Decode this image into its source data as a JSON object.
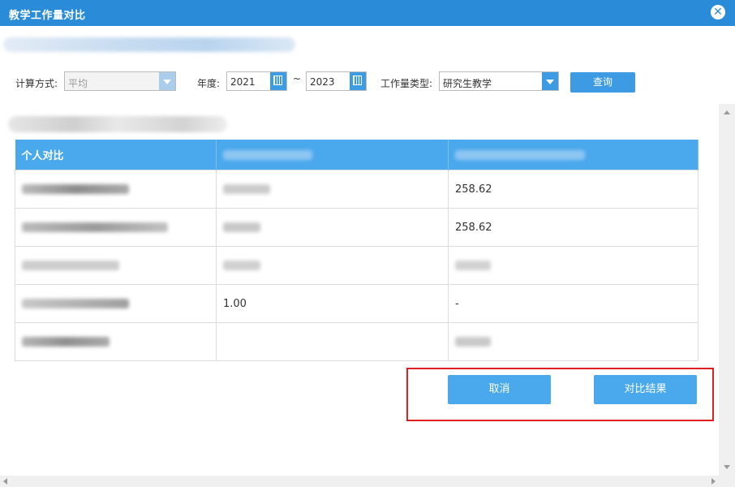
{
  "dialog": {
    "title": "教学工作量对比"
  },
  "filters": {
    "calc_method_label": "计算方式:",
    "calc_method_value": "平均",
    "year_label": "年度:",
    "year_from": "2021",
    "range_sep": "~",
    "year_to": "2023",
    "workload_type_label": "工作量类型:",
    "workload_type_value": "研究生教学",
    "query_label": "查询"
  },
  "table": {
    "headers": [
      "个人对比",
      "",
      ""
    ],
    "rows": [
      [
        "",
        "",
        "258.62"
      ],
      [
        "",
        "",
        "258.62"
      ],
      [
        "",
        "",
        ""
      ],
      [
        "",
        "1.00",
        "-"
      ],
      [
        "",
        "",
        ""
      ]
    ]
  },
  "actions": {
    "cancel_label": "取消",
    "compare_label": "对比结果"
  },
  "colors": {
    "titlebar": "#2a8bd8",
    "accent": "#4aa8ec",
    "highlight_border": "#e02020"
  }
}
